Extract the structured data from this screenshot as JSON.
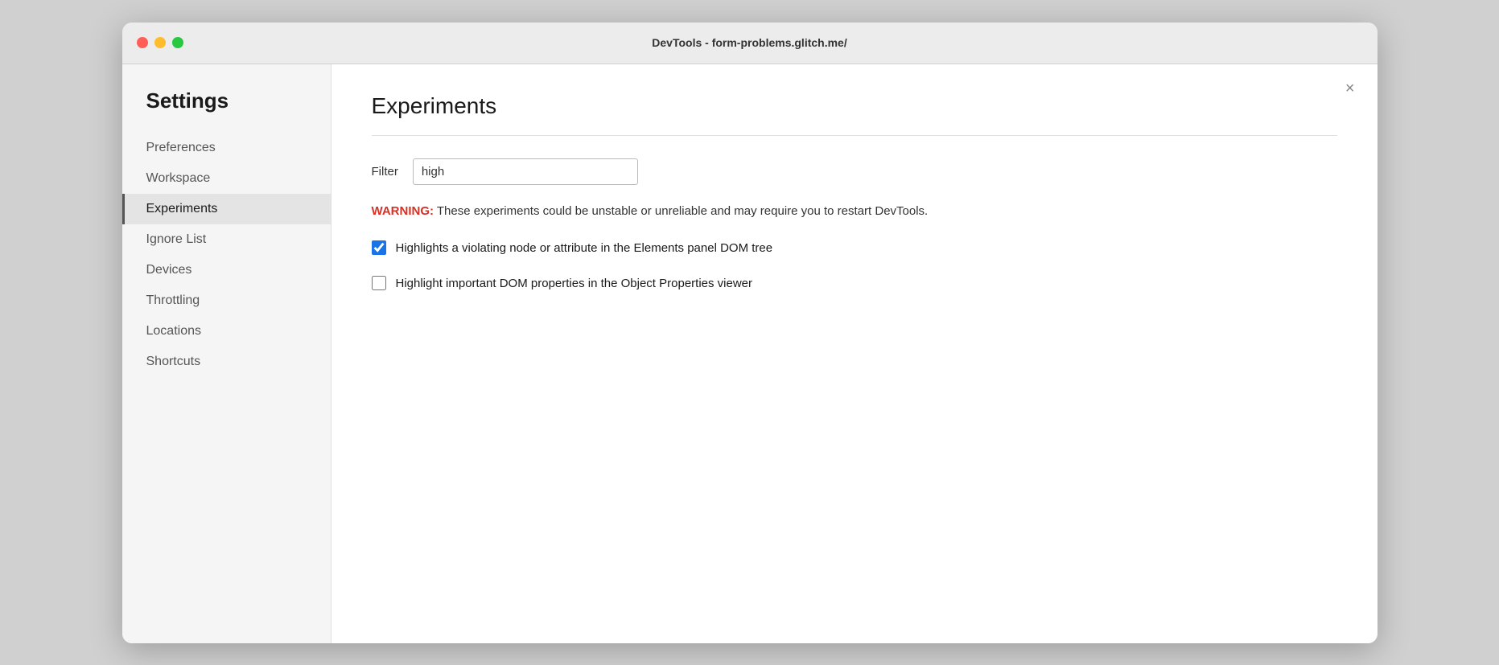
{
  "titlebar": {
    "title": "DevTools - form-problems.glitch.me/"
  },
  "sidebar": {
    "heading": "Settings",
    "items": [
      {
        "id": "preferences",
        "label": "Preferences",
        "active": false
      },
      {
        "id": "workspace",
        "label": "Workspace",
        "active": false
      },
      {
        "id": "experiments",
        "label": "Experiments",
        "active": true
      },
      {
        "id": "ignore-list",
        "label": "Ignore List",
        "active": false
      },
      {
        "id": "devices",
        "label": "Devices",
        "active": false
      },
      {
        "id": "throttling",
        "label": "Throttling",
        "active": false
      },
      {
        "id": "locations",
        "label": "Locations",
        "active": false
      },
      {
        "id": "shortcuts",
        "label": "Shortcuts",
        "active": false
      }
    ]
  },
  "main": {
    "title": "Experiments",
    "close_button": "×",
    "filter": {
      "label": "Filter",
      "value": "high",
      "placeholder": ""
    },
    "warning": {
      "prefix": "WARNING:",
      "message": " These experiments could be unstable or unreliable and may require you to restart DevTools."
    },
    "checkboxes": [
      {
        "id": "checkbox-1",
        "label": "Highlights a violating node or attribute in the Elements panel DOM tree",
        "checked": true
      },
      {
        "id": "checkbox-2",
        "label": "Highlight important DOM properties in the Object Properties viewer",
        "checked": false
      }
    ]
  },
  "colors": {
    "warning_red": "#d93025",
    "checkbox_blue": "#1a73e8",
    "active_sidebar_bar": "#555"
  }
}
